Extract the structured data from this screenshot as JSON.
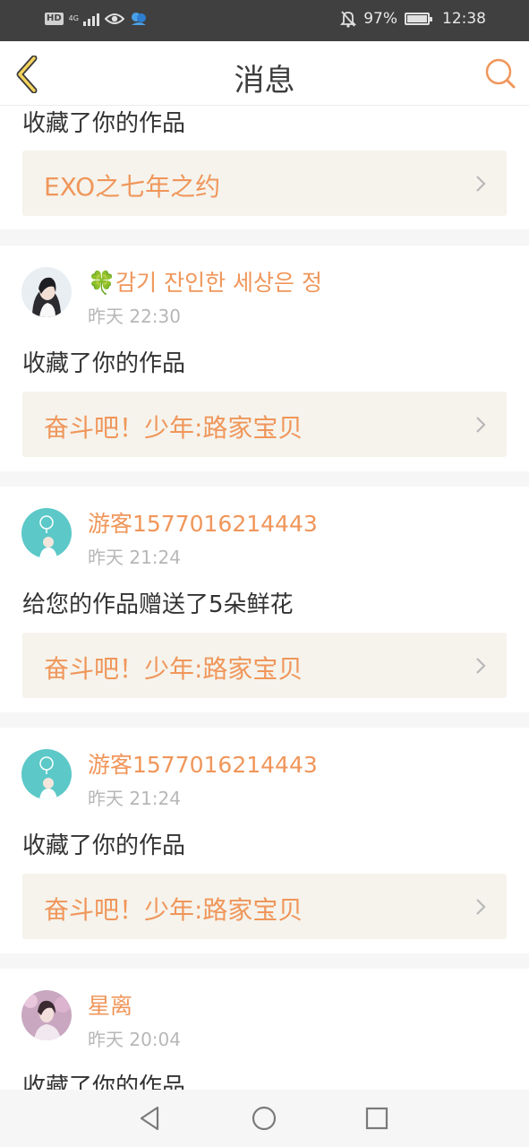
{
  "status_bar": {
    "hd": "HD",
    "network": "4G",
    "battery_percent": "97%",
    "battery_level": 0.97,
    "time": "12:38",
    "icons": [
      "hd-icon",
      "signal-icon",
      "eye-icon",
      "app-icon",
      "mute-icon",
      "battery-icon"
    ]
  },
  "header": {
    "title": "消息",
    "back_icon": "chevron-left-icon",
    "search_icon": "search-icon",
    "accent_color": "#f0965a"
  },
  "messages": [
    {
      "action": "收藏了你的作品",
      "work_title": "EXO之七年之约"
    },
    {
      "user": "🍀감기 잔인한 세상은 정",
      "time": "昨天 22:30",
      "action": "收藏了你的作品",
      "work_title": "奋斗吧！少年:路家宝贝"
    },
    {
      "user": "游客1577016214443",
      "time": "昨天 21:24",
      "action": "给您的作品赠送了5朵鲜花",
      "work_title": "奋斗吧！少年:路家宝贝"
    },
    {
      "user": "游客1577016214443",
      "time": "昨天 21:24",
      "action": "收藏了你的作品",
      "work_title": "奋斗吧！少年:路家宝贝"
    },
    {
      "user": "星离",
      "time": "昨天 20:04",
      "action": "收藏了你的作品"
    }
  ],
  "nav": {
    "icons": [
      "back-triangle-icon",
      "home-circle-icon",
      "recents-square-icon"
    ]
  }
}
